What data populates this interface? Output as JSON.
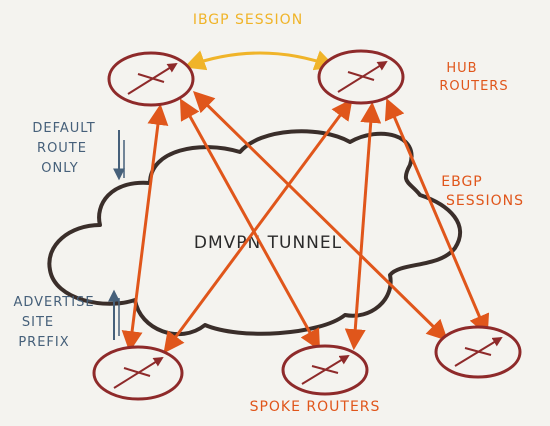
{
  "labels": {
    "ibgp": "IBGP SESSION",
    "hub_line1": "HUB",
    "hub_line2": "ROUTERS",
    "default_line1": "DEFAULT",
    "default_line2": "ROUTE",
    "default_line3": "ONLY",
    "ebgp_line1": "EBGP",
    "ebgp_line2": "SESSIONS",
    "tunnel": "DMVPN TUNNEL",
    "advertise_line1": "ADVERTISE",
    "advertise_line2": "SITE",
    "advertise_line3": "PREFIX",
    "spoke": "SPOKE ROUTERS"
  },
  "colors": {
    "background": "#f4f3ef",
    "router": "#8e2a2a",
    "ebgp": "#e0561b",
    "ibgp": "#f0b429",
    "annotation": "#46607a",
    "tunnel": "#3a2e2a"
  },
  "routers": [
    {
      "id": "hub-1",
      "role": "hub"
    },
    {
      "id": "hub-2",
      "role": "hub"
    },
    {
      "id": "spoke-1",
      "role": "spoke"
    },
    {
      "id": "spoke-2",
      "role": "spoke"
    },
    {
      "id": "spoke-3",
      "role": "spoke"
    }
  ]
}
